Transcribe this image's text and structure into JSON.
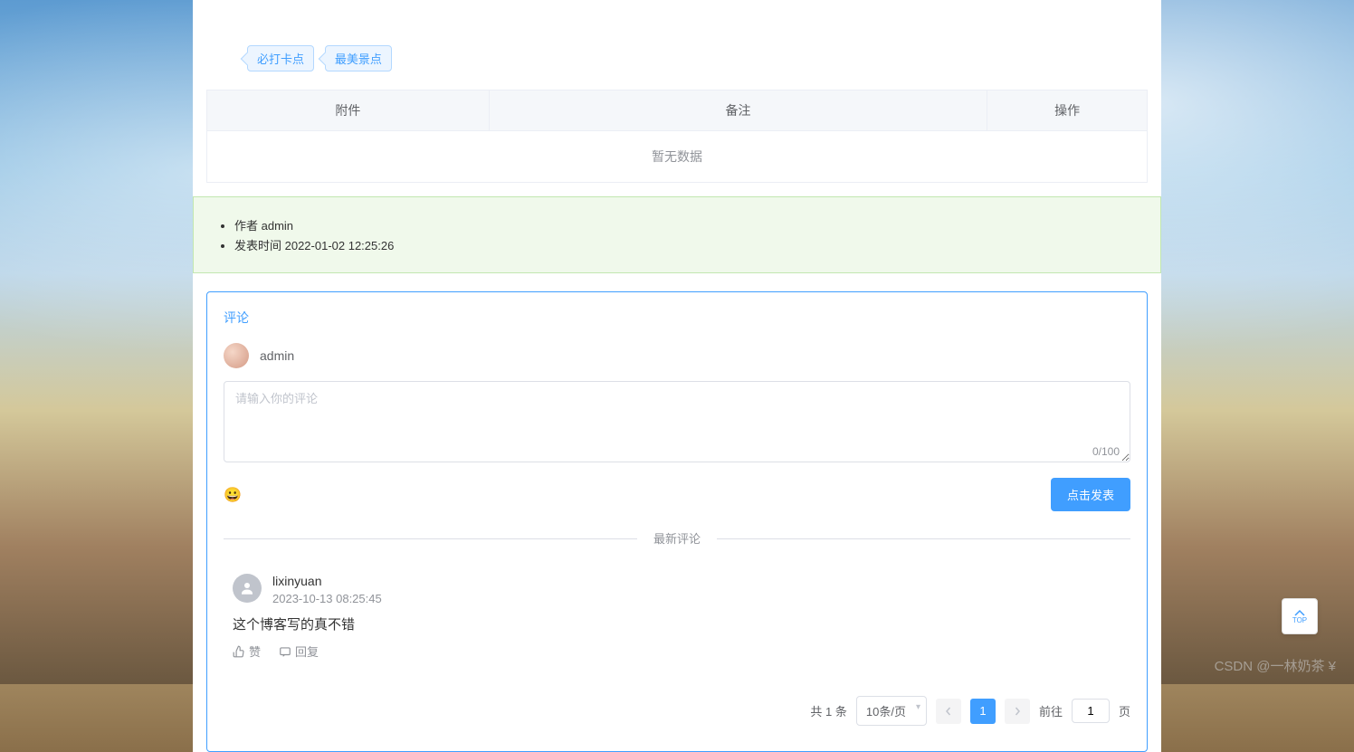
{
  "tags": [
    "必打卡点",
    "最美景点"
  ],
  "table": {
    "headers": [
      "附件",
      "备注",
      "操作"
    ],
    "empty_text": "暂无数据"
  },
  "info": {
    "author_label": "作者 admin",
    "publish_label": "发表时间 2022-01-02 12:25:26"
  },
  "comment_section": {
    "title": "评论",
    "current_user": "admin",
    "textarea_placeholder": "请输入你的评论",
    "char_count": "0/100",
    "emoji": "😀",
    "submit_label": "点击发表",
    "divider_label": "最新评论"
  },
  "comments": [
    {
      "name": "lixinyuan",
      "time": "2023-10-13 08:25:45",
      "content": "这个博客写的真不错",
      "like_label": "赞",
      "reply_label": "回复"
    }
  ],
  "pagination": {
    "total_text": "共 1 条",
    "page_size": "10条/页",
    "current_page": "1",
    "goto_prefix": "前往",
    "goto_value": "1",
    "goto_suffix": "页"
  },
  "back_top": "TOP",
  "watermark": "CSDN @一林奶茶 ¥"
}
